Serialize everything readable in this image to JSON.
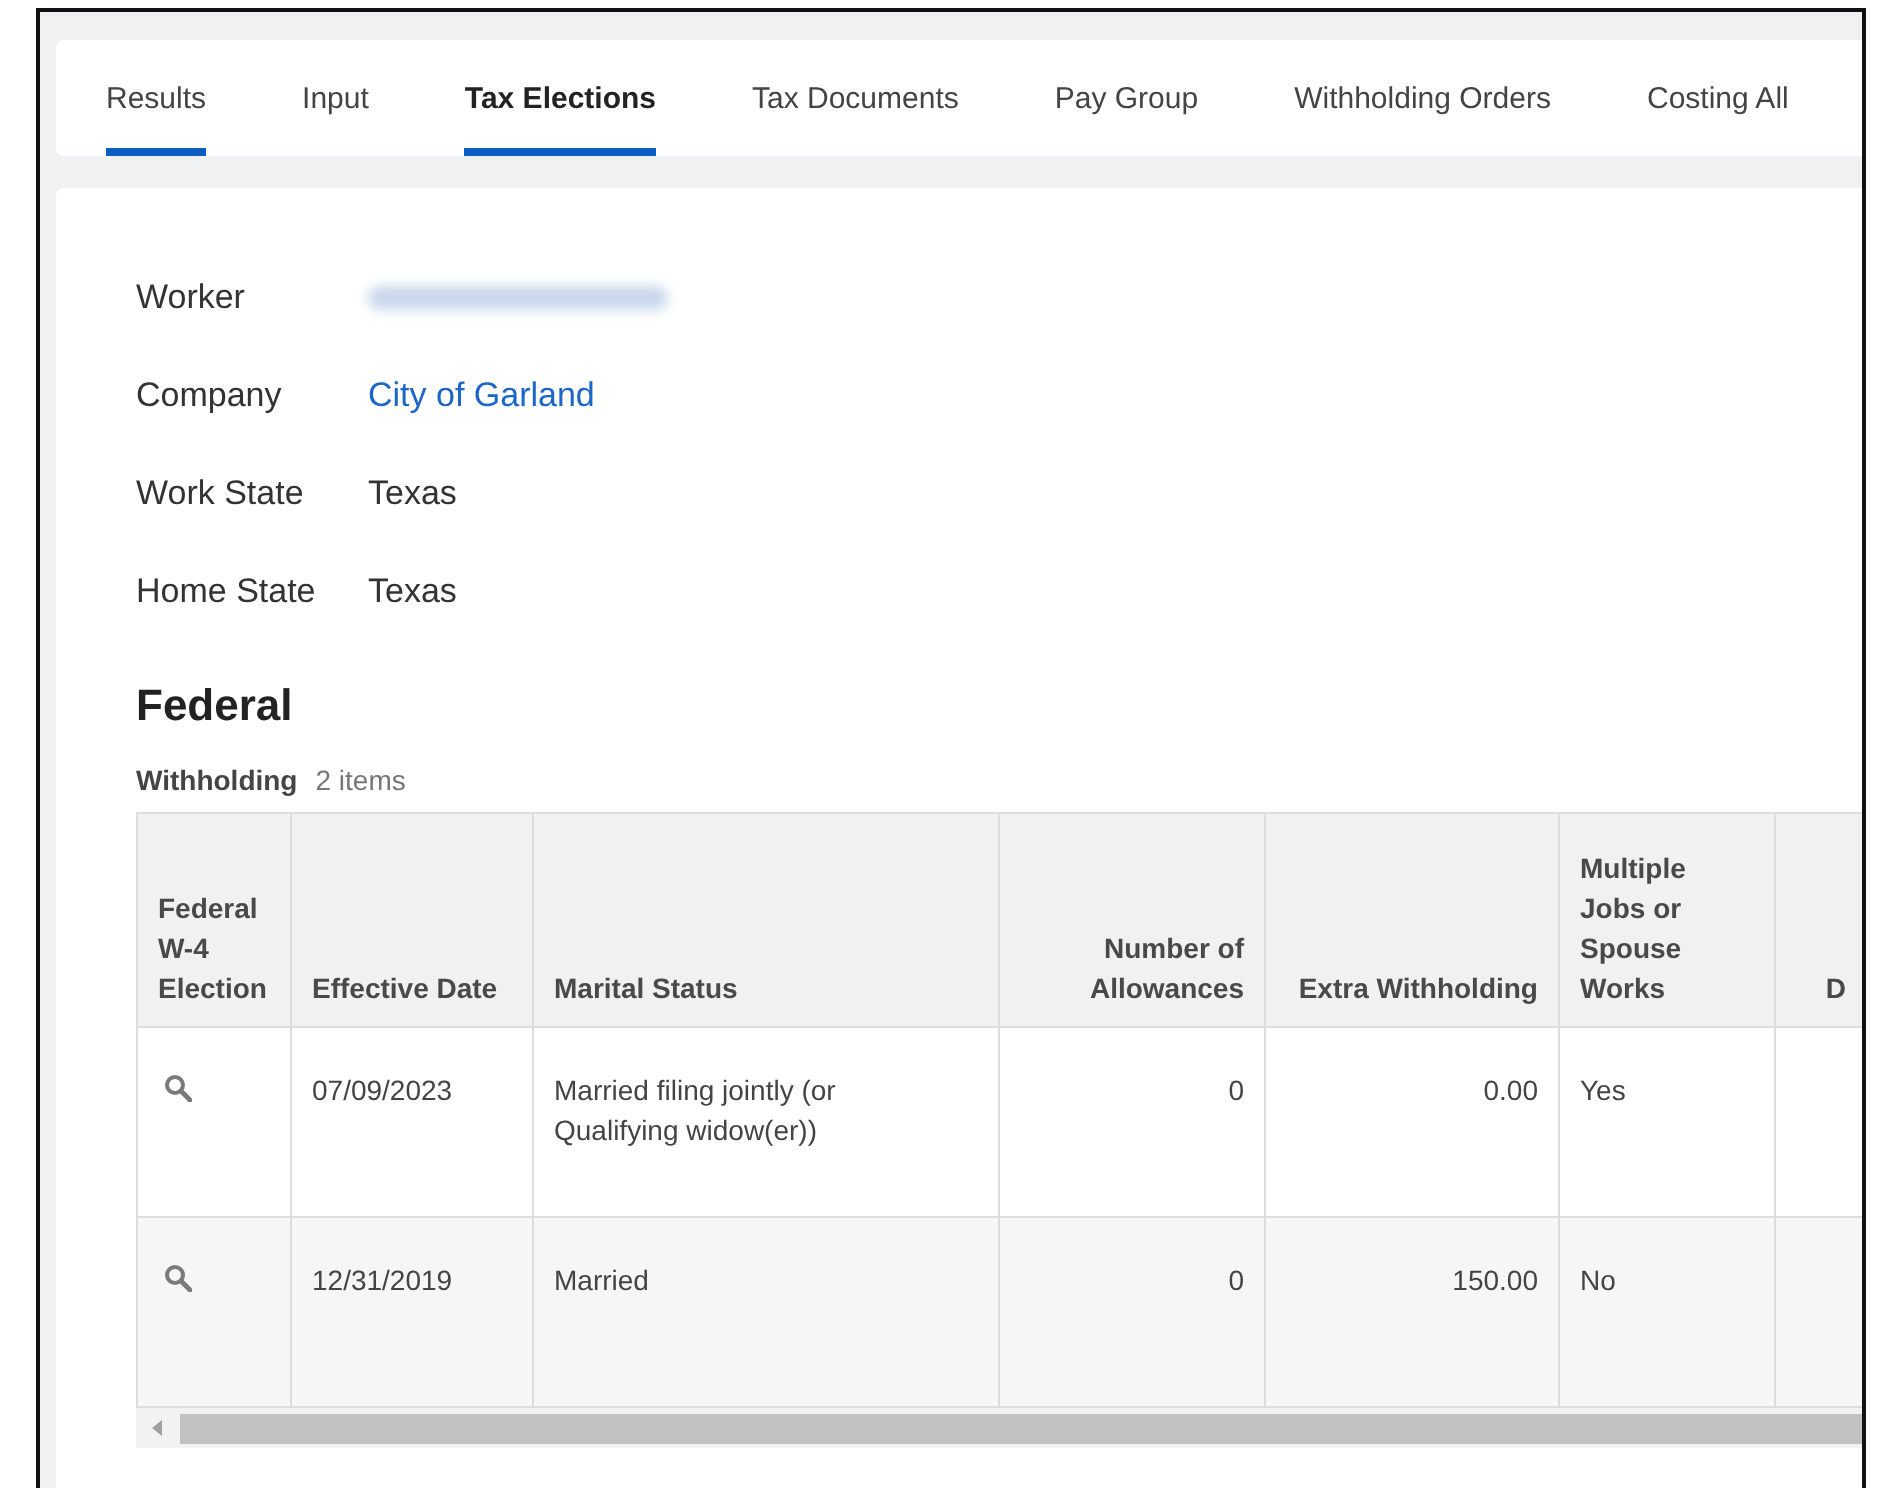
{
  "tabs": [
    {
      "label": "Results",
      "selected": false,
      "underlined": true
    },
    {
      "label": "Input",
      "selected": false,
      "underlined": false
    },
    {
      "label": "Tax Elections",
      "selected": true,
      "underlined": true
    },
    {
      "label": "Tax Documents",
      "selected": false,
      "underlined": false
    },
    {
      "label": "Pay Group",
      "selected": false,
      "underlined": false
    },
    {
      "label": "Withholding Orders",
      "selected": false,
      "underlined": false
    },
    {
      "label": "Costing All",
      "selected": false,
      "underlined": false
    }
  ],
  "fields": [
    {
      "label": "Worker",
      "kind": "redacted"
    },
    {
      "label": "Company",
      "kind": "link",
      "value": "City of Garland"
    },
    {
      "label": "Work State",
      "kind": "text",
      "value": "Texas"
    },
    {
      "label": "Home State",
      "kind": "text",
      "value": "Texas"
    }
  ],
  "section_title": "Federal",
  "table": {
    "title": "Withholding",
    "count": "2 items",
    "columns": [
      {
        "label": "Federal W-4 Election",
        "kind": "text"
      },
      {
        "label": "Effective Date",
        "kind": "text"
      },
      {
        "label": "Marital Status",
        "kind": "text"
      },
      {
        "label": "Number of Allowances",
        "kind": "number"
      },
      {
        "label": "Extra Withholding",
        "kind": "number"
      },
      {
        "label": "Multiple Jobs or Spouse Works",
        "kind": "text"
      },
      {
        "label": "D",
        "kind": "number"
      }
    ],
    "rows": [
      {
        "date": "07/09/2023",
        "marital_status": "Married filing jointly (or Qualifying widow(er))",
        "allowances": "0",
        "extra_withholding": "0.00",
        "multiple_jobs": "Yes"
      },
      {
        "date": "12/31/2019",
        "marital_status": "Married",
        "allowances": "0",
        "extra_withholding": "150.00",
        "multiple_jobs": "No"
      }
    ]
  }
}
